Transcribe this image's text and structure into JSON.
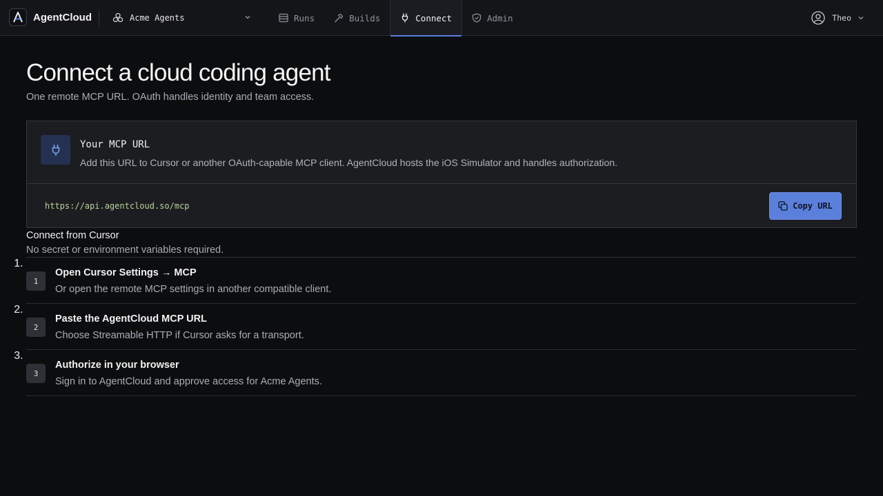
{
  "app": {
    "brand": "AgentCloud",
    "workspace": "Acme Agents",
    "user": "Theo",
    "accent_color": "#5b80db"
  },
  "nav": {
    "items": [
      {
        "label": "Runs",
        "icon": "list-icon"
      },
      {
        "label": "Builds",
        "icon": "hammer-icon"
      },
      {
        "label": "Connect",
        "icon": "plug-icon",
        "active": true
      },
      {
        "label": "Admin",
        "icon": "shield-icon"
      }
    ]
  },
  "page": {
    "title": "Connect a cloud coding agent",
    "subtitle": "One remote MCP URL. OAuth handles identity and team access."
  },
  "mcp": {
    "title": "Your MCP URL",
    "description": "Add this URL to Cursor or another OAuth-capable MCP client. AgentCloud hosts the iOS Simulator and handles authorization.",
    "url": "https://api.agentcloud.so/mcp",
    "copy_label": "Copy URL"
  },
  "connect": {
    "title": "Connect from Cursor",
    "subtitle": "No secret or environment variables required.",
    "steps": [
      {
        "number": "1",
        "title": "Open Cursor Settings → MCP",
        "description": "Or open the remote MCP settings in another compatible client."
      },
      {
        "number": "2",
        "title": "Paste the AgentCloud MCP URL",
        "description": "Choose Streamable HTTP if Cursor asks for a transport."
      },
      {
        "number": "3",
        "title": "Authorize in your browser",
        "description": "Sign in to AgentCloud and approve access for Acme Agents."
      }
    ]
  }
}
